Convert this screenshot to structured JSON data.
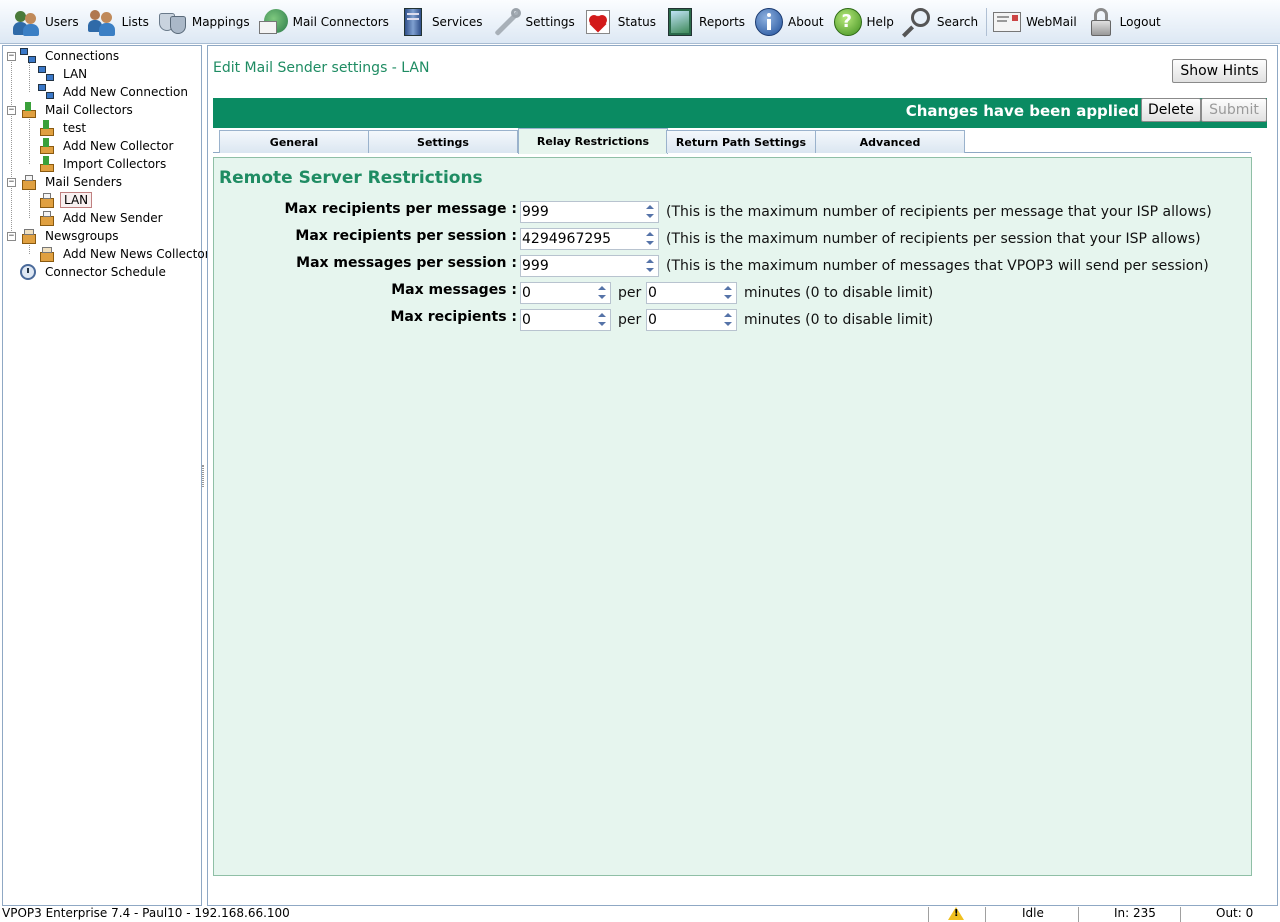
{
  "toolbar": {
    "items": [
      {
        "label": "Users",
        "icon": "users-icon"
      },
      {
        "label": "Lists",
        "icon": "lists-icon"
      },
      {
        "label": "Mappings",
        "icon": "masks-icon"
      },
      {
        "label": "Mail Connectors",
        "icon": "globe-mail-icon"
      },
      {
        "label": "Services",
        "icon": "server-icon"
      },
      {
        "label": "Settings",
        "icon": "wrench-icon"
      },
      {
        "label": "Status",
        "icon": "heart-icon"
      },
      {
        "label": "Reports",
        "icon": "chart-icon"
      },
      {
        "label": "About",
        "icon": "info-icon"
      },
      {
        "label": "Help",
        "icon": "help-icon"
      },
      {
        "label": "Search",
        "icon": "magnifier-icon"
      },
      {
        "label": "WebMail",
        "icon": "envelope-icon"
      },
      {
        "label": "Logout",
        "icon": "padlock-icon"
      }
    ]
  },
  "sidebar": {
    "connections": "Connections",
    "connections_lan": "LAN",
    "add_new_connection": "Add New Connection",
    "mail_collectors": "Mail Collectors",
    "collector_test": "test",
    "add_new_collector": "Add New Collector",
    "import_collectors": "Import Collectors",
    "mail_senders": "Mail Senders",
    "sender_lan": "LAN",
    "add_new_sender": "Add New Sender",
    "newsgroups": "Newsgroups",
    "add_new_news_collector": "Add New News Collector",
    "connector_schedule": "Connector Schedule"
  },
  "page": {
    "title": "Edit Mail Sender settings - LAN",
    "show_hints": "Show Hints",
    "status_message": "Changes have been applied",
    "delete": "Delete",
    "submit": "Submit"
  },
  "tabs": [
    "General",
    "Settings",
    "Relay Restrictions",
    "Return Path Settings",
    "Advanced"
  ],
  "active_tab": "Relay Restrictions",
  "form": {
    "section_title": "Remote Server Restrictions",
    "max_recipients_per_message": {
      "label": "Max recipients per message :",
      "value": "999",
      "hint": "(This is the maximum number of recipients per message that your ISP allows)"
    },
    "max_recipients_per_session": {
      "label": "Max recipients per session :",
      "value": "4294967295",
      "hint": "(This is the maximum number of recipients per session that your ISP allows)"
    },
    "max_messages_per_session": {
      "label": "Max messages per session :",
      "value": "999",
      "hint": "(This is the maximum number of messages that VPOP3 will send per session)"
    },
    "max_messages": {
      "label": "Max messages :",
      "value": "0",
      "per": "per",
      "minutes_value": "0",
      "hint": "minutes (0 to disable limit)"
    },
    "max_recipients": {
      "label": "Max recipients :",
      "value": "0",
      "per": "per",
      "minutes_value": "0",
      "hint": "minutes (0 to disable limit)"
    }
  },
  "statusbar": {
    "app_info": "VPOP3 Enterprise 7.4 - Paul10 - 192.168.66.100",
    "state": "Idle",
    "in": "In: 235",
    "out": "Out: 0"
  },
  "colors": {
    "accent_green": "#0a8b62",
    "title_green": "#1f8c63",
    "content_bg": "#e6f5ee"
  }
}
